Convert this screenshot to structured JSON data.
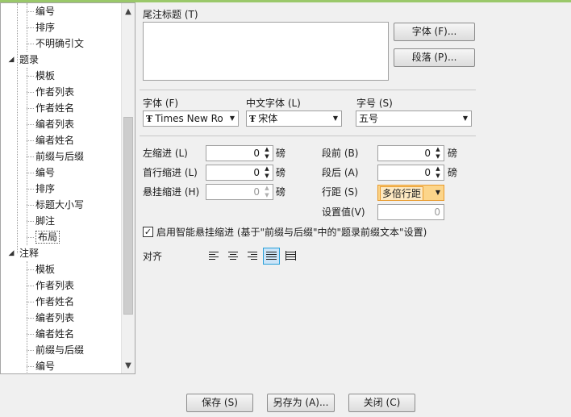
{
  "tree": {
    "items": [
      {
        "label": "编号",
        "level": 2
      },
      {
        "label": "排序",
        "level": 2
      },
      {
        "label": "不明确引文",
        "level": 2
      },
      {
        "label": "题录",
        "level": 1,
        "toggle": "expanded"
      },
      {
        "label": "模板",
        "level": 2
      },
      {
        "label": "作者列表",
        "level": 2
      },
      {
        "label": "作者姓名",
        "level": 2
      },
      {
        "label": "编者列表",
        "level": 2
      },
      {
        "label": "编者姓名",
        "level": 2
      },
      {
        "label": "前缀与后缀",
        "level": 2
      },
      {
        "label": "编号",
        "level": 2
      },
      {
        "label": "排序",
        "level": 2
      },
      {
        "label": "标题大小写",
        "level": 2
      },
      {
        "label": "脚注",
        "level": 2
      },
      {
        "label": "布局",
        "level": 2,
        "selected": true
      },
      {
        "label": "注释",
        "level": 1,
        "toggle": "expanded"
      },
      {
        "label": "模板",
        "level": 2
      },
      {
        "label": "作者列表",
        "level": 2
      },
      {
        "label": "作者姓名",
        "level": 2
      },
      {
        "label": "编者列表",
        "level": 2
      },
      {
        "label": "编者姓名",
        "level": 2
      },
      {
        "label": "前缀与后缀",
        "level": 2
      },
      {
        "label": "编号",
        "level": 2
      }
    ],
    "toggle_glyph": "◢"
  },
  "caption": {
    "label": "尾注标题 (T)",
    "value": "",
    "font_button": "字体 (F)...",
    "paragraph_button": "段落 (P)..."
  },
  "font": {
    "font_label": "字体 (F)",
    "font_value": "Times New Roman",
    "cn_font_label": "中文字体 (L)",
    "cn_font_value": "宋体",
    "size_label": "字号 (S)",
    "size_value": "五号",
    "font_icon": "truetype-font-icon"
  },
  "indent": {
    "left_label": "左缩进 (L)",
    "left_value": "0",
    "first_label": "首行缩进 (L)",
    "first_value": "0",
    "hanging_label": "悬挂缩进 (H)",
    "hanging_value": "0",
    "unit": "磅"
  },
  "spacing": {
    "before_label": "段前 (B)",
    "before_value": "0",
    "after_label": "段后 (A)",
    "after_value": "0",
    "line_label": "行距 (S)",
    "line_value": "多倍行距",
    "setting_label": "设置值(V)",
    "setting_value": "0",
    "unit": "磅"
  },
  "smart_hanging": {
    "checked": true,
    "label": "启用智能悬挂缩进 (基于\"前缀与后缀\"中的\"题录前缀文本\"设置)"
  },
  "align": {
    "label": "对齐",
    "options": [
      "align-left-icon",
      "align-center-icon",
      "align-right-icon",
      "align-justify-icon",
      "align-distributed-icon"
    ],
    "active": "align-justify-icon"
  },
  "footer": {
    "save": "保存 (S)",
    "save_as": "另存为 (A)...",
    "close": "关闭 (C)"
  },
  "colors": {
    "line_combo_bg": "#fcd58a",
    "line_combo_border": "#e89a2c",
    "active_align_bg": "#cce4f7",
    "top_accent": "#9ac86a"
  }
}
